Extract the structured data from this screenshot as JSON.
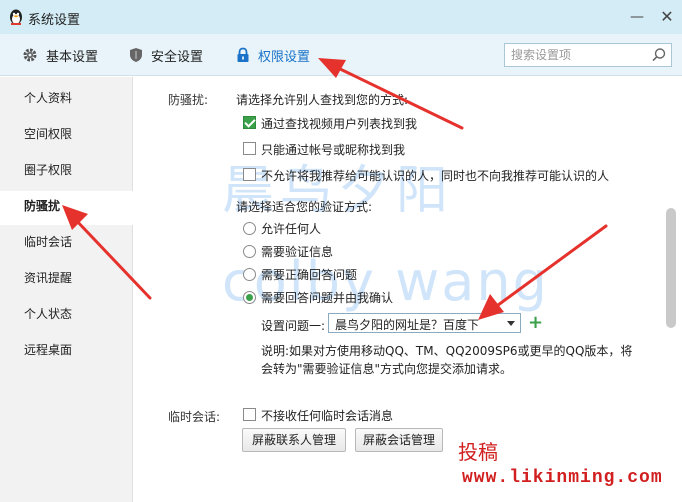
{
  "window": {
    "title": "系统设置",
    "minimize_glyph": "—",
    "close_glyph": "✕"
  },
  "toolbar": {
    "basic_label": "基本设置",
    "security_label": "安全设置",
    "permission_label": "权限设置",
    "search_placeholder": "搜索设置项"
  },
  "sidebar": {
    "items": [
      {
        "label": "个人资料"
      },
      {
        "label": "空间权限"
      },
      {
        "label": "圈子权限"
      },
      {
        "label": "防骚扰"
      },
      {
        "label": "临时会话"
      },
      {
        "label": "资讯提醒"
      },
      {
        "label": "个人状态"
      },
      {
        "label": "远程桌面"
      }
    ],
    "active_index": 3
  },
  "anti_harass": {
    "section_label": "防骚扰:",
    "find_prompt": "请选择允许别人查找到您的方式:",
    "find_options": [
      {
        "label": "通过查找视频用户列表找到我",
        "checked": true
      },
      {
        "label": "只能通过帐号或昵称找到我",
        "checked": false
      },
      {
        "label": "不允许将我推荐给可能认识的人，同时也不向我推荐可能认识的人",
        "checked": false
      }
    ],
    "verify_prompt": "请选择适合您的验证方式:",
    "verify_options": [
      {
        "label": "允许任何人",
        "selected": false
      },
      {
        "label": "需要验证信息",
        "selected": false
      },
      {
        "label": "需要正确回答问题",
        "selected": false
      },
      {
        "label": "需要回答问题并由我确认",
        "selected": true
      }
    ],
    "question_label": "设置问题一:",
    "question_value": "晨鸟夕阳的网址是？百度下",
    "add_glyph": "+",
    "note_line1": "说明:如果对方使用移动QQ、TM、QQ2009SP6或更早的QQ版本，将",
    "note_line2": "会转为\"需要验证信息\"方式向您提交添加请求。"
  },
  "temp_session": {
    "section_label": "临时会话:",
    "option_label": "不接收任何临时会话消息",
    "option_checked": false,
    "block_contacts_button": "屏蔽联系人管理",
    "block_sessions_button": "屏蔽会话管理"
  },
  "watermark": {
    "line1": "晨鸟夕阳",
    "line2": "colby wang"
  },
  "overlay": {
    "tougao": "投稿",
    "site": "www.likinming.com"
  },
  "colors": {
    "accent_blue": "#1a73c9",
    "check_green": "#3aa14a",
    "annotation_red": "#e5322d",
    "titlebar_bg": "#d3ecf5"
  }
}
